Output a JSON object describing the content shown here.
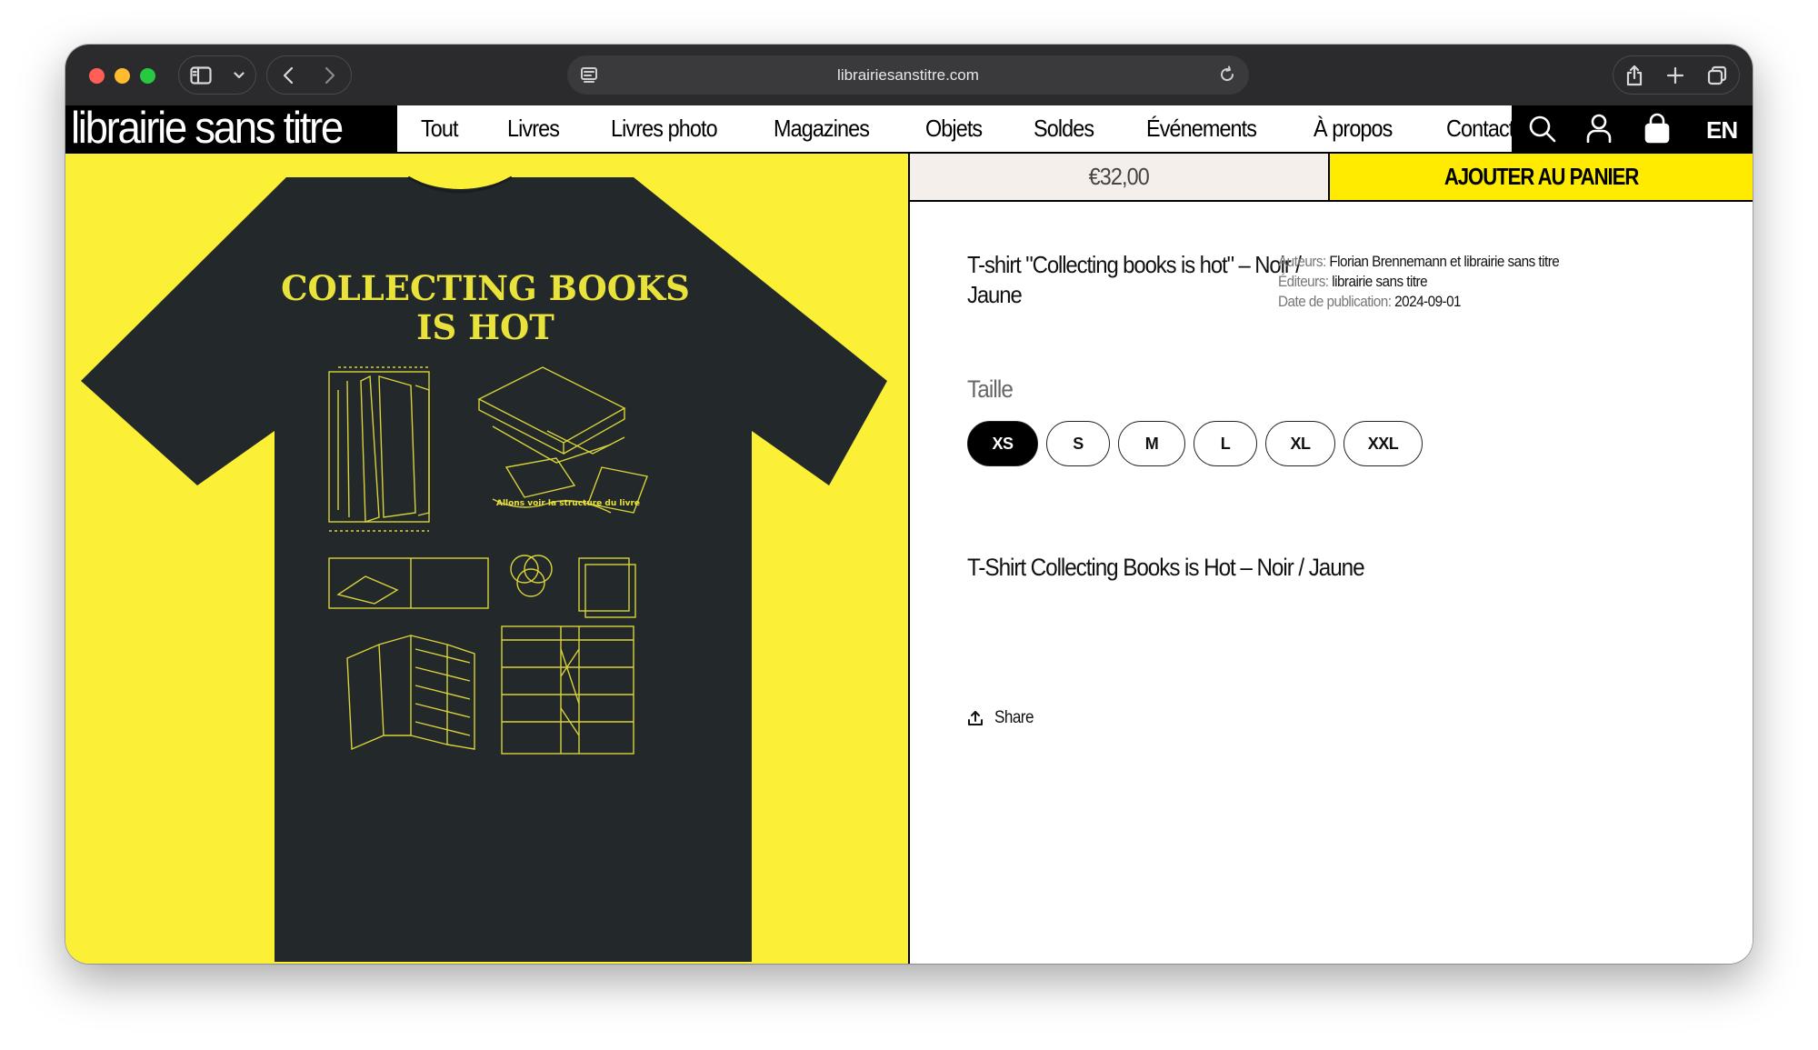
{
  "browser": {
    "url": "librairiesanstitre.com"
  },
  "site": {
    "logo": "librairie sans titre",
    "nav": [
      {
        "label": "Tout"
      },
      {
        "label": "Livres"
      },
      {
        "label": "Livres photo"
      },
      {
        "label": "Magazines"
      },
      {
        "label": "Objets"
      },
      {
        "label": "Soldes"
      },
      {
        "label": "Événements"
      },
      {
        "label": "À propos"
      },
      {
        "label": "Contact"
      }
    ],
    "lang": "EN"
  },
  "product": {
    "shirt_print": {
      "headline_line1": "COLLECTING BOOKS",
      "headline_line2": "IS HOT",
      "diagram_caption": "Allons voir la structure du livre"
    },
    "price": "€32,00",
    "cart_label": "AJOUTER AU PANIER",
    "title": "T-shirt \"Collecting books is hot\" – Noir / Jaune",
    "meta": {
      "authors_key": "Auteurs:",
      "authors_val": "Florian Brennemann et librairie sans titre",
      "publishers_key": "Éditeurs:",
      "publishers_val": "librairie sans titre",
      "date_key": "Date de publication:",
      "date_val": "2024-09-01"
    },
    "size_label": "Taille",
    "sizes": [
      "XS",
      "S",
      "M",
      "L",
      "XL",
      "XXL"
    ],
    "selected_size": "XS",
    "description": "T-Shirt Collecting Books is Hot – Noir / Jaune",
    "share_label": "Share"
  },
  "colors": {
    "accent_yellow": "#ffeb00",
    "image_bg": "#fbf035",
    "shirt": "#23282a",
    "print": "#e8e23a"
  }
}
